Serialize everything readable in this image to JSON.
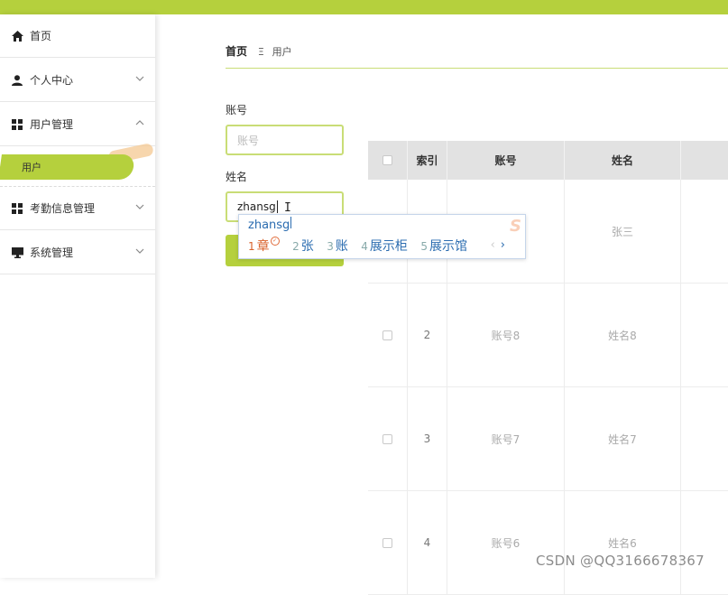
{
  "colors": {
    "accent": "#b5d03d",
    "accent_light": "#c9dd76",
    "ime_blue": "#2b6cb0"
  },
  "sidebar": {
    "items": [
      {
        "label": "首页",
        "icon": "home-icon"
      },
      {
        "label": "个人中心",
        "icon": "user-icon"
      },
      {
        "label": "用户管理",
        "icon": "grid-icon",
        "expanded": true
      },
      {
        "label": "考勤信息管理",
        "icon": "grid-icon"
      },
      {
        "label": "系统管理",
        "icon": "monitor-icon"
      }
    ],
    "sub_items": [
      {
        "label": "用户",
        "active": true
      }
    ]
  },
  "breadcrumb": {
    "home": "首页",
    "separator": "Ξ",
    "current": "用户"
  },
  "form": {
    "account_label": "账号",
    "account_placeholder": "账号",
    "name_label": "姓名",
    "name_value": "zhansg"
  },
  "table": {
    "headers": [
      "",
      "索引",
      "账号",
      "姓名"
    ],
    "rows": [
      {
        "index": "",
        "account": "",
        "name": "张三"
      },
      {
        "index": "2",
        "account": "账号8",
        "name": "姓名8"
      },
      {
        "index": "3",
        "account": "账号7",
        "name": "姓名7"
      },
      {
        "index": "4",
        "account": "账号6",
        "name": "姓名6"
      }
    ]
  },
  "ime": {
    "composition": "zhansg",
    "candidates": [
      {
        "num": "1",
        "text": "章"
      },
      {
        "num": "2",
        "text": "张"
      },
      {
        "num": "3",
        "text": "账"
      },
      {
        "num": "4",
        "text": "展示柜"
      },
      {
        "num": "5",
        "text": "展示馆"
      }
    ],
    "prev": "‹",
    "next": "›"
  },
  "watermark": "CSDN @QQ3166678367"
}
